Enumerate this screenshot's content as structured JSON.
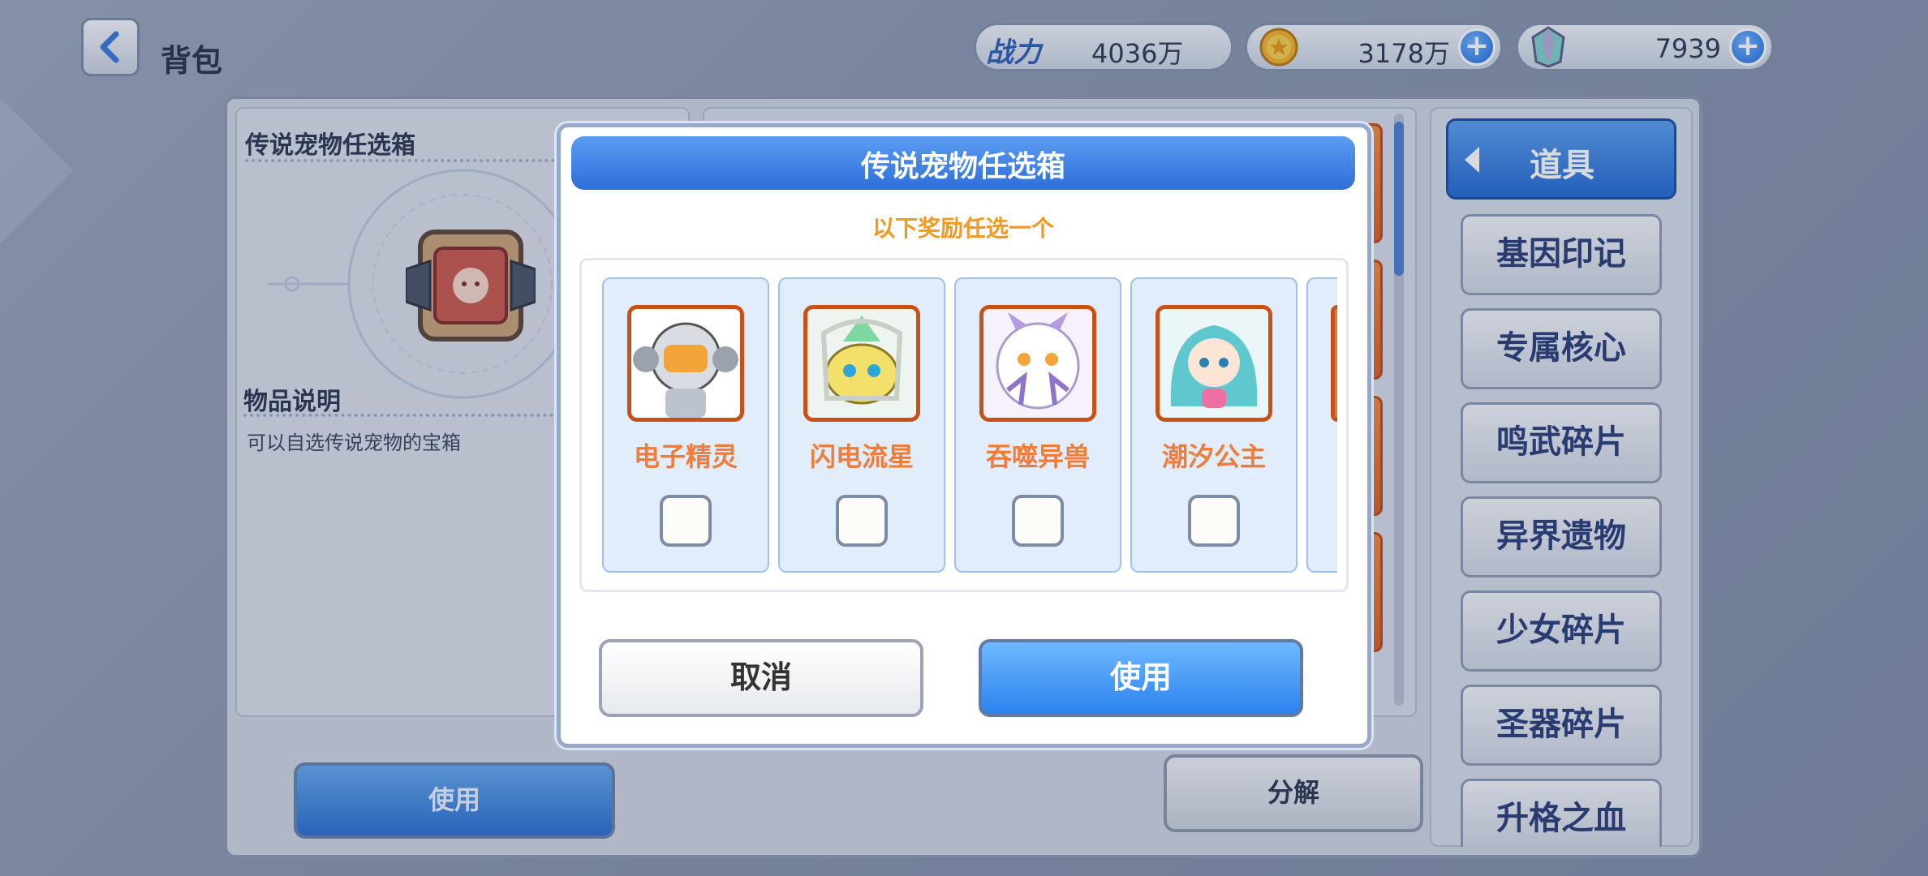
{
  "header": {
    "title": "背包",
    "power_label": "战力",
    "power_value": "4036万",
    "gold_value": "3178万",
    "gem_value": "7939"
  },
  "info": {
    "item_title": "传说宠物任选箱",
    "desc_title": "物品说明",
    "desc_text": "可以自选传说宠物的宝箱"
  },
  "bottom": {
    "use_label": "使用",
    "decompose_label": "分解"
  },
  "categories": {
    "active": "道具",
    "items": [
      "基因印记",
      "专属核心",
      "鸣武碎片",
      "异界遗物",
      "少女碎片",
      "圣器碎片",
      "升格之血"
    ]
  },
  "dialog": {
    "title": "传说宠物任选箱",
    "hint": "以下奖励任选一个",
    "options": [
      {
        "name": "电子精灵",
        "checked": false
      },
      {
        "name": "闪电流星",
        "checked": false
      },
      {
        "name": "吞噬异兽",
        "checked": false
      },
      {
        "name": "潮汐公主",
        "checked": false
      }
    ],
    "cancel_label": "取消",
    "confirm_label": "使用"
  },
  "colors": {
    "accent_blue": "#2d6fd9",
    "pet_name": "#f07c3a",
    "hint": "#f39a1e"
  }
}
